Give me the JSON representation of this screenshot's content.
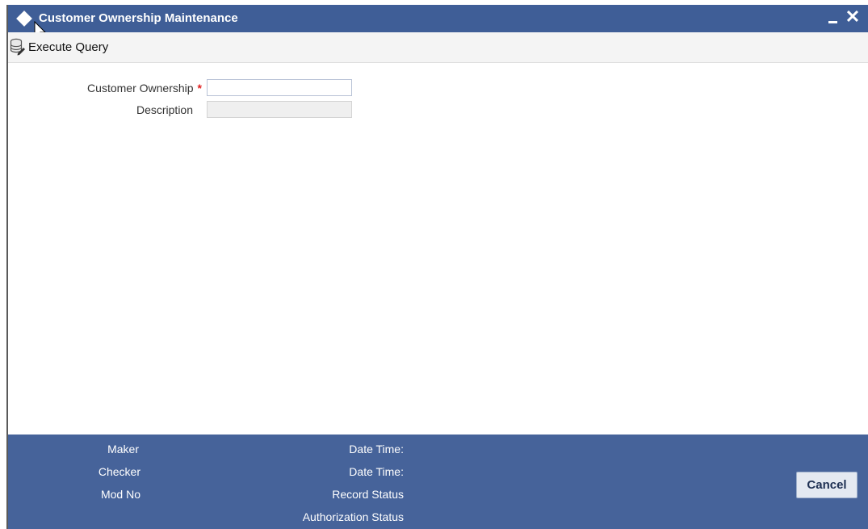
{
  "window": {
    "title": "Customer Ownership Maintenance",
    "close_glyph": "✕",
    "icons": {
      "title": "diamond-icon",
      "minimize": "minimize-icon",
      "close": "close-icon"
    }
  },
  "toolbar": {
    "execute_query_label": "Execute Query",
    "execute_query_icon": "database-query-icon"
  },
  "form": {
    "customer_ownership": {
      "label": "Customer Ownership",
      "required_mark": "*",
      "value": ""
    },
    "description": {
      "label": "Description",
      "value": ""
    }
  },
  "footer": {
    "maker_label": "Maker",
    "checker_label": "Checker",
    "mod_no_label": "Mod No",
    "maker_date_time_label": "Date Time:",
    "checker_date_time_label": "Date Time:",
    "record_status_label": "Record Status",
    "authorization_status_label": "Authorization Status",
    "cancel_label": "Cancel"
  },
  "colors": {
    "titlebar": "#3f5e97",
    "footer": "#46639a",
    "required": "#e02020"
  }
}
